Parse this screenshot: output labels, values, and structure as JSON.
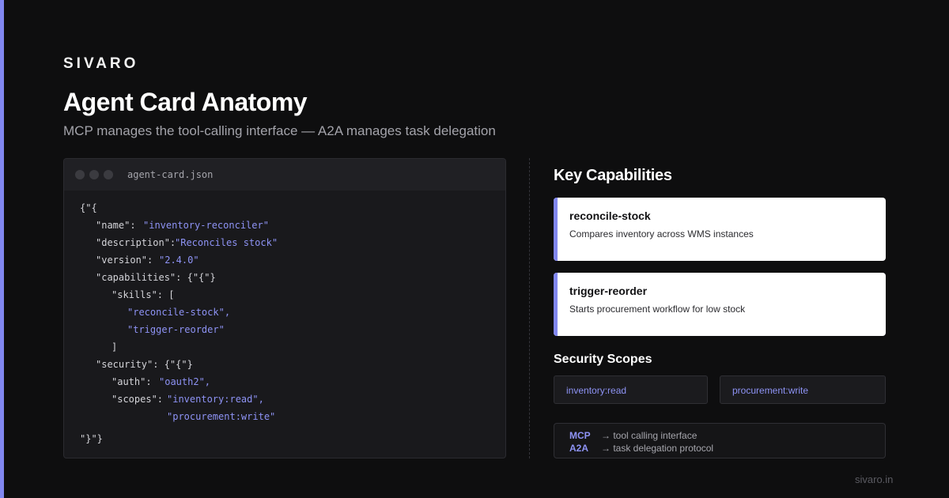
{
  "brand": "SIVARO",
  "title": "Agent Card Anatomy",
  "subtitle": "MCP manages the tool-calling interface — A2A manages task delegation",
  "code": {
    "filename": "agent-card.json",
    "lines": {
      "open": "{\"{",
      "name_key": "\"name\":",
      "name_val": "\"inventory-reconciler\"",
      "desc_key": "\"description\":",
      "desc_val": "\"Reconciles stock\"",
      "version_key": "\"version\":",
      "version_val": "\"2.4.0\"",
      "capabilities": "\"capabilities\": {\"{\"}",
      "skills": "\"skills\": [",
      "skill1": "\"reconcile-stock\",",
      "skill2": "\"trigger-reorder\"",
      "skills_close": "]",
      "security": "\"security\": {\"{\"}",
      "auth_key": "\"auth\":",
      "auth_val": "\"oauth2\",",
      "scopes_key": "\"scopes\":",
      "scope1": "\"inventory:read\",",
      "scope2": "\"procurement:write\"",
      "close": "\"}\"}"
    }
  },
  "capabilities": {
    "title": "Key Capabilities",
    "items": [
      {
        "name": "reconcile-stock",
        "desc": "Compares inventory across WMS instances"
      },
      {
        "name": "trigger-reorder",
        "desc": "Starts procurement workflow for low stock"
      }
    ]
  },
  "security": {
    "title": "Security Scopes",
    "scopes": [
      "inventory:read",
      "procurement:write"
    ]
  },
  "legend": [
    {
      "key": "MCP",
      "value": "→ tool calling interface"
    },
    {
      "key": "A2A",
      "value": "→ task delegation protocol"
    }
  ],
  "footer": "sivaro.in",
  "colors": {
    "accent": "#8187f0",
    "background": "#0e0e0f",
    "code_value": "#8e93f5"
  }
}
